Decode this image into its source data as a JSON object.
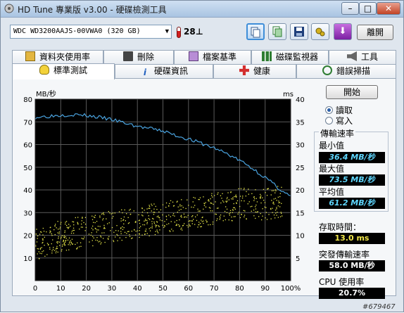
{
  "window": {
    "title": "HD Tune 專業版 v3.00 - 硬碟檢測工具",
    "min": "–",
    "max": "□",
    "close": "✕"
  },
  "toolbar": {
    "drive": "WDC WD3200AAJS-00VWA0 (320 GB)",
    "temperature": "28",
    "temp_unit": "⊥",
    "exit_label": "離開",
    "icons": [
      "copy-text-icon",
      "copy-screen-icon",
      "save-icon",
      "options-icon",
      "download-icon"
    ]
  },
  "tabs_top": [
    {
      "label": "資料夾使用率",
      "icon": "folder-icon"
    },
    {
      "label": "刪除",
      "icon": "trash-icon"
    },
    {
      "label": "檔案基準",
      "icon": "file-benchmark-icon"
    },
    {
      "label": "磁碟監視器",
      "icon": "disk-monitor-icon"
    },
    {
      "label": "工具",
      "icon": "speaker-icon"
    }
  ],
  "tabs_bottom": [
    {
      "label": "標準測試",
      "icon": "bulb-icon"
    },
    {
      "label": "硬碟資訊",
      "icon": "info-icon"
    },
    {
      "label": "健康",
      "icon": "health-icon"
    },
    {
      "label": "錯誤掃描",
      "icon": "magnifier-icon"
    }
  ],
  "controls": {
    "start": "開始",
    "read": "讀取",
    "write": "寫入",
    "selected": "read"
  },
  "stats": {
    "transfer_header": "傳輸速率",
    "min_label": "最小值",
    "min_value": "36.4 MB/秒",
    "max_label": "最大值",
    "max_value": "73.5 MB/秒",
    "avg_label": "平均值",
    "avg_value": "61.2 MB/秒",
    "access_label": "存取時間：",
    "access_value": "13.0 ms",
    "burst_label": "突發傳輸速率",
    "burst_value": "58.0 MB/秒",
    "cpu_label": "CPU 使用率",
    "cpu_value": "20.7%"
  },
  "watermark": "#679467",
  "colors": {
    "transfer": "#4aa3df",
    "access": "#e8e84a",
    "plot_bg": "#000000",
    "grid": "#5a5a5a"
  },
  "chart_data": {
    "type": "line",
    "ylabel_left": "MB/秒",
    "ylabel_right": "ms",
    "ylim_left": [
      0,
      80
    ],
    "ylim_right": [
      0,
      40
    ],
    "yticks_left": [
      10,
      20,
      30,
      40,
      50,
      60,
      70,
      80
    ],
    "yticks_right": [
      5,
      10,
      15,
      20,
      25,
      30,
      35,
      40
    ],
    "xticks": [
      "0",
      "10",
      "20",
      "30",
      "40",
      "50",
      "60",
      "70",
      "80",
      "90",
      "100%"
    ],
    "grid": true,
    "series": [
      {
        "type": "line",
        "axis": "left",
        "x": [
          0,
          5,
          10,
          15,
          20,
          25,
          30,
          35,
          40,
          45,
          50,
          55,
          60,
          65,
          70,
          75,
          80,
          85,
          90,
          95,
          100
        ],
        "y": [
          72,
          72.5,
          73,
          73.2,
          72.8,
          72,
          71,
          69.5,
          68,
          67,
          66,
          64,
          62.5,
          60.5,
          58.5,
          56,
          53,
          49.5,
          45.5,
          41,
          37
        ]
      },
      {
        "type": "scatter",
        "axis": "right",
        "description_range_ms": "3-18",
        "x": [
          0,
          10,
          20,
          30,
          40,
          50,
          60,
          70,
          80,
          90,
          100
        ],
        "y": [
          8,
          10,
          11,
          12,
          13,
          14,
          15,
          16,
          17,
          17,
          18
        ]
      }
    ]
  }
}
